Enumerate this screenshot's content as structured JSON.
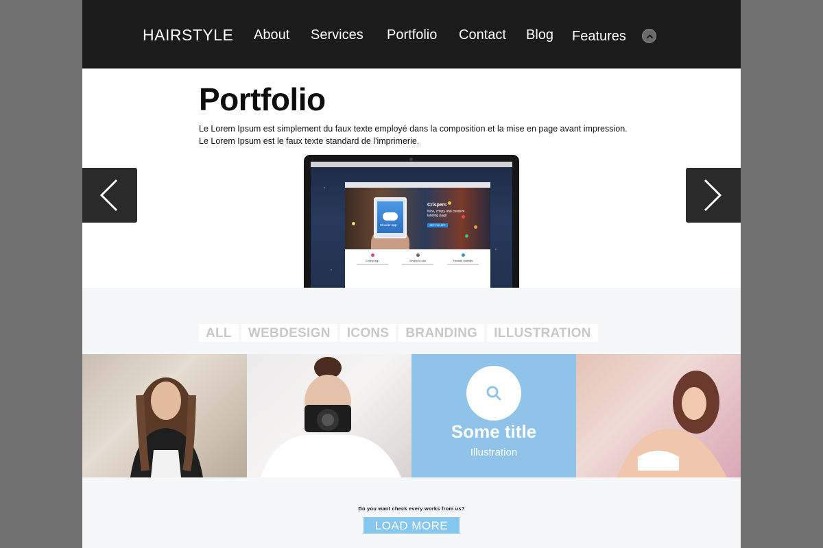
{
  "header": {
    "logo": "HAIRSTYLE",
    "nav": [
      "About",
      "Services",
      "Portfolio",
      "Contact",
      "Blog",
      "Features"
    ]
  },
  "hero": {
    "title": "Portfolio",
    "text_line1": "Le Lorem Ipsum est simplement du faux texte employé dans la composition et la mise en page avant impression.",
    "text_line2": "Le Lorem Ipsum est le faux texte standard de l'imprimerie."
  },
  "laptop_screen": {
    "tablet_label": "Clouder app",
    "headline": "Crispers",
    "subline": "Nice, crispy and creative landing page",
    "button": "GET THE APP",
    "features": [
      "Lovely app",
      "Simply to use",
      "Flexible settings"
    ]
  },
  "filters": [
    "ALL",
    "WEBDESIGN",
    "ICONS",
    "BRANDING",
    "ILLUSTRATION"
  ],
  "grid": {
    "overlay_title": "Some title",
    "overlay_subtitle": "Illustration"
  },
  "cta": {
    "question": "Do you want check every works from us?",
    "button": "LOAD MORE"
  },
  "colors": {
    "header_bg": "#1b1b1b",
    "accent_blue": "#86c7ef",
    "overlay_blue": "#8fc3ea",
    "filter_text": "#c8c8c8"
  }
}
